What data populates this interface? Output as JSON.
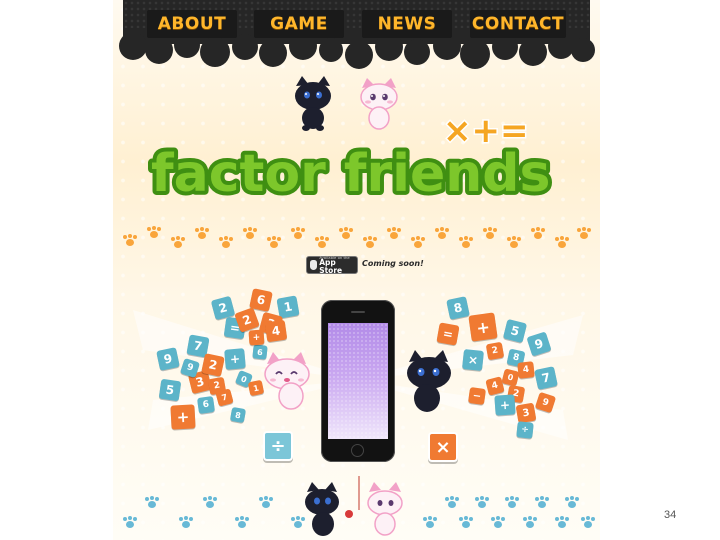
{
  "nav": {
    "about": "ABOUT",
    "game": "GAME",
    "news": "NEWS",
    "contact": "CONTACT"
  },
  "logo": {
    "text": "factor friends",
    "symbols": "×+=",
    "fill_color": "#7dc72b",
    "outline_color": "#3f8f12",
    "symbol_color": "#f5a623"
  },
  "app_store": {
    "small_text": "Available on the",
    "store_name": "App Store",
    "status": "Coming soon!"
  },
  "slide_number": "34",
  "colors": {
    "nav_bar": "#262626",
    "nav_text": "#ffb62b",
    "orange_tile": "#f07a32",
    "blue_tile": "#5cb4c9",
    "paw_orange": "#f9a53b",
    "paw_blue": "#68b9d6"
  },
  "tiles_left": [
    "2",
    "6",
    "1",
    "=",
    "2",
    "3",
    "4",
    "9",
    "7",
    "+",
    "5",
    "3",
    "2",
    "+",
    "9",
    "2",
    "0",
    "1",
    "6",
    "8",
    "7",
    "6",
    "+"
  ],
  "tiles_right": [
    "8",
    "=",
    "+",
    "5",
    "9",
    "×",
    "2",
    "8",
    "4",
    "0",
    "7",
    "−",
    "4",
    "2",
    "+",
    "9",
    "3",
    "÷"
  ],
  "buttons": {
    "divide": "÷",
    "multiply": "×"
  },
  "icons": [
    "cat-icon",
    "apple-icon",
    "paw-icon",
    "phone-icon"
  ]
}
